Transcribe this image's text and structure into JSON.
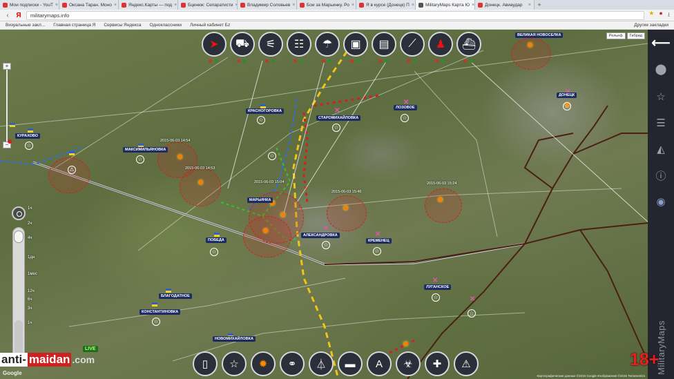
{
  "browser": {
    "tabs": [
      {
        "label": "Мои подписки - YouT"
      },
      {
        "label": "Оксана Таран. Моно"
      },
      {
        "label": "Яндекс.Карты — под"
      },
      {
        "label": "Бценюк: Сепаратисти"
      },
      {
        "label": "Владимир Соловьев"
      },
      {
        "label": "Бои за Марьинку. Ро"
      },
      {
        "label": "Я в курсе (Донецк) П"
      },
      {
        "label": "MilitaryMaps Карта Ю"
      },
      {
        "label": "Донецк. Авиаудар"
      }
    ],
    "active_tab": 7,
    "url": "militarymaps.info",
    "bookmarks": [
      "Визуальные закл...",
      "Главная страница Я",
      "Сервисы Яндекса",
      "Одноклассники",
      "Личный кабинет Бz"
    ],
    "other_bookmarks": "Другие закладки"
  },
  "map": {
    "layer_buttons": [
      "Рельеф",
      "Гибрид"
    ],
    "unit_toolbar": [
      {
        "name": "unit-sniper-icon",
        "glyph": "➤",
        "red": true
      },
      {
        "name": "unit-car-icon",
        "glyph": "⛟"
      },
      {
        "name": "unit-artillery-icon",
        "glyph": "⚟"
      },
      {
        "name": "unit-mlrs-icon",
        "glyph": "☷"
      },
      {
        "name": "unit-paratrooper-icon",
        "glyph": "☂"
      },
      {
        "name": "unit-tank-icon",
        "glyph": "▣"
      },
      {
        "name": "unit-heavy-tank-icon",
        "glyph": "▤"
      },
      {
        "name": "unit-howitzer-icon",
        "glyph": "⟋"
      },
      {
        "name": "unit-soldier-icon",
        "glyph": "♟",
        "red": true
      },
      {
        "name": "unit-ship-icon",
        "glyph": "⛴"
      }
    ],
    "event_toolbar": [
      {
        "name": "event-document-icon",
        "glyph": "▯"
      },
      {
        "name": "event-star-icon",
        "glyph": "☆"
      },
      {
        "name": "event-fire-icon",
        "glyph": "✹",
        "flame": true
      },
      {
        "name": "event-route-icon",
        "glyph": "⚭"
      },
      {
        "name": "event-network-icon",
        "glyph": "⏃"
      },
      {
        "name": "event-barrier-icon",
        "glyph": "▬"
      },
      {
        "name": "event-airport-icon",
        "glyph": "A"
      },
      {
        "name": "event-biohazard-icon",
        "glyph": "☣"
      },
      {
        "name": "event-medical-icon",
        "glyph": "✚"
      },
      {
        "name": "event-warning-icon",
        "glyph": "⚠"
      }
    ],
    "places": [
      {
        "label": "КУРАХОВО"
      },
      {
        "label": "МАКСИМИЛЬЯНОВКА"
      },
      {
        "label": "КРАСНОГОРОВКА"
      },
      {
        "label": "СТАРОМИХАЙЛОВКА"
      },
      {
        "label": "МАРЬИНКА"
      },
      {
        "label": "АЛЕКСАНДРОВКА"
      },
      {
        "label": "ПОБЕДА"
      },
      {
        "label": "БЛАГОДАТНОЕ"
      },
      {
        "label": "КОНСТАНТИНОВКА"
      },
      {
        "label": "НОВОМИХАЙЛОВКА"
      },
      {
        "label": "КРЕМЕНЕЦ"
      },
      {
        "label": "ЛУГАНСКОЕ"
      },
      {
        "label": "ДОНЕЦК"
      },
      {
        "label": "ЛОЗОВОЕ"
      },
      {
        "label": "ВЕЛИКАЯ НОВОСЕЛКА"
      }
    ],
    "timestamps": [
      "2015-06-03 14:54",
      "2015-06-03 14:53",
      "2015-06-03 15:46",
      "2015-06-03 15:24",
      "2015-06-03 15:04"
    ],
    "time_scale": [
      "1ч",
      "2ч",
      "4ч",
      "1дн",
      "1мес",
      "12ч",
      "6ч",
      "3ч",
      "1ч"
    ],
    "live_label": "LIVE",
    "google_label": "Google",
    "copyright": "Картографические данные ©2015 Google Изображения ©2015 Terrametrics"
  },
  "branding": {
    "anti": "anti-",
    "maidan": "maidan",
    "dotcom": ".com",
    "vertical": "MilitaryMaps",
    "age": "18+"
  }
}
